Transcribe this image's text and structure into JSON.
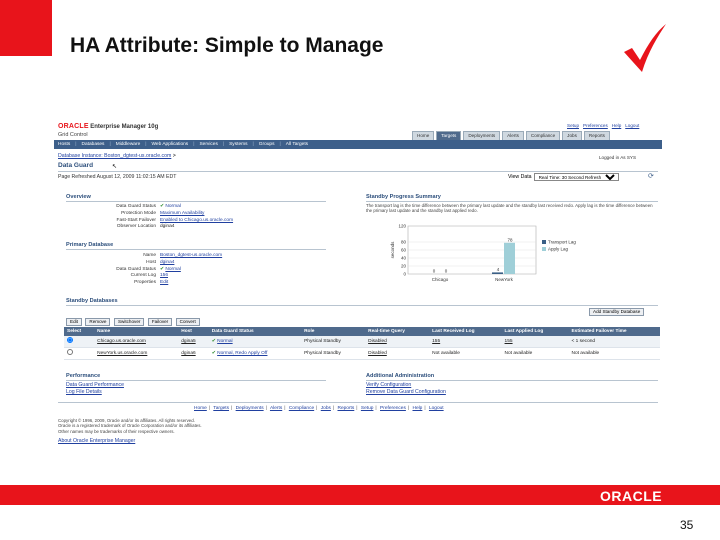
{
  "slide": {
    "title": "HA Attribute: Simple to Manage",
    "page_number": "35",
    "footer_logo": "ORACLE",
    "colors": {
      "accent_red": "#e8141b",
      "nav_blue": "#3d5f8a",
      "header_blue": "#4f6a8c"
    },
    "check_icon": "checkmark-icon"
  },
  "app": {
    "logo_oracle": "ORACLE",
    "logo_product": "Enterprise Manager 10g",
    "logo_sub": "Grid Control",
    "global_links": [
      "Setup",
      "Preferences",
      "Help",
      "Logout"
    ],
    "tabs": [
      {
        "label": "Home",
        "active": false
      },
      {
        "label": "Targets",
        "active": true
      },
      {
        "label": "Deployments",
        "active": false
      },
      {
        "label": "Alerts",
        "active": false
      },
      {
        "label": "Compliance",
        "active": false
      },
      {
        "label": "Jobs",
        "active": false
      },
      {
        "label": "Reports",
        "active": false
      }
    ],
    "subnav": [
      "Hosts",
      "Databases",
      "Middleware",
      "Web Applications",
      "Services",
      "Systems",
      "Groups",
      "All Targets"
    ],
    "breadcrumb": "Database Instance: Boston_dgtest-us.oracle.com",
    "breadcrumb_sep": ">",
    "logged_in": "Logged in As SYS",
    "page_title": "Data Guard",
    "refreshed": "Page Refreshed August 12, 2009 11:02:15 AM EDT",
    "view_label": "View Data",
    "view_value": "Real Time: 30 Second Refresh"
  },
  "overview": {
    "heading": "Overview",
    "rows": [
      {
        "label": "Data Guard Status",
        "value": "Normal"
      },
      {
        "label": "Protection Mode",
        "value": "Maximum Availability"
      },
      {
        "label": "Fast-Start Failover",
        "value": "Enabled to Chicago.us.oracle.com"
      },
      {
        "label": "Observer Location",
        "value": "dgina4"
      }
    ]
  },
  "primary": {
    "heading": "Primary Database",
    "rows": [
      {
        "label": "Name",
        "value": "Boston_dgtest-us.oracle.com"
      },
      {
        "label": "Host",
        "value": "dgina4"
      },
      {
        "label": "Data Guard Status",
        "value": "Normal"
      },
      {
        "label": "Current Log",
        "value": "156"
      },
      {
        "label": "Properties",
        "value": "Edit"
      }
    ]
  },
  "progress": {
    "heading": "Standby Progress Summary",
    "description": "The transport lag is the time difference between the primary last update and the standby last received redo. Apply lag is the time difference between the primary last update and the standby last applied redo.",
    "ylabel": "seconds"
  },
  "chart_data": {
    "type": "bar",
    "categories": [
      "Chicago",
      "NewYork"
    ],
    "series": [
      {
        "name": "Transport Lag",
        "values": [
          0,
          4
        ],
        "color": "#3a5f86"
      },
      {
        "name": "Apply Lag",
        "values": [
          0,
          78
        ],
        "color": "#9fcfd8"
      }
    ],
    "data_labels": [
      "0",
      "0",
      "4",
      "78"
    ],
    "ylabel": "seconds",
    "ylim": [
      0,
      120
    ],
    "yticks": [
      "120",
      "80",
      "60",
      "40",
      "20",
      "0"
    ],
    "grid": true,
    "legend": "right"
  },
  "standby": {
    "heading": "Standby Databases",
    "add_button": "Add Standby Database",
    "buttons": [
      "Edit",
      "Remove",
      "Switchover",
      "Failover",
      "Convert"
    ],
    "columns": [
      "Select",
      "Name",
      "Host",
      "Data Guard Status",
      "Role",
      "Real-time Query",
      "Last Received Log",
      "Last Applied Log",
      "Estimated Failover Time"
    ],
    "rows": [
      {
        "name": "Chicago.us.oracle.com",
        "host": "dgina5",
        "status": "Normal",
        "role": "Physical Standby",
        "rtq": "Disabled",
        "recv": "155",
        "applied": "155",
        "failover": "< 1 second"
      },
      {
        "name": "NewYork.us.oracle.com",
        "host": "dgina6",
        "status": "Normal, Redo Apply Off",
        "role": "Physical Standby",
        "rtq": "Disabled",
        "recv": "Not available",
        "applied": "Not available",
        "failover": "Not available"
      }
    ]
  },
  "performance": {
    "heading": "Performance",
    "links": [
      "Data Guard Performance",
      "Log File Details"
    ]
  },
  "admin": {
    "heading": "Additional Administration",
    "links": [
      "Verify Configuration",
      "Remove Data Guard Configuration"
    ]
  },
  "footer": {
    "links": [
      "Home",
      "Targets",
      "Deployments",
      "Alerts",
      "Compliance",
      "Jobs",
      "Reports",
      "Setup",
      "Preferences",
      "Help",
      "Logout"
    ],
    "copyright": [
      "Copyright © 1996, 2009, Oracle and/or its affiliates. All rights reserved.",
      "Oracle is a registered trademark of Oracle Corporation and/or its affiliates.",
      "Other names may be trademarks of their respective owners."
    ],
    "about": "About Oracle Enterprise Manager"
  }
}
